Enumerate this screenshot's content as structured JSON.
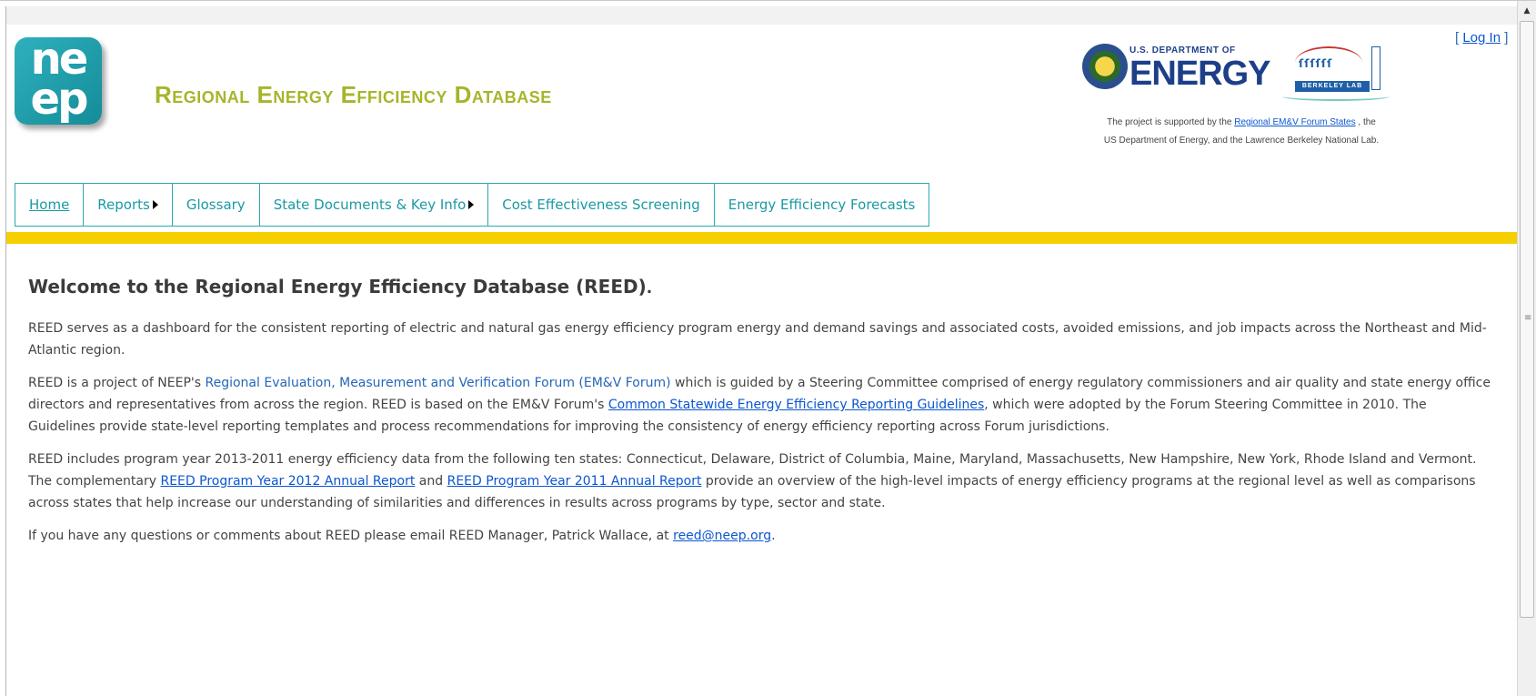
{
  "header": {
    "logo_text": "ne\nep",
    "site_title": "Regional Energy Efficiency Database",
    "login": {
      "open": "[",
      "label": "Log In",
      "close": "]"
    },
    "doe": {
      "small": "U.S. DEPARTMENT OF",
      "big": "ENERGY"
    },
    "berkeley": {
      "label": "BERKELEY LAB"
    },
    "support": {
      "pre": "The project is supported by the ",
      "link": "Regional EM&V Forum States",
      "post": " , the",
      "line2": "US Department of Energy, and the Lawrence Berkeley National Lab."
    }
  },
  "nav": {
    "items": [
      {
        "label": "Home",
        "has_arrow": false,
        "active": true
      },
      {
        "label": "Reports",
        "has_arrow": true
      },
      {
        "label": "Glossary",
        "has_arrow": false
      },
      {
        "label": "State Documents & Key Info",
        "has_arrow": true
      },
      {
        "label": "Cost Effectiveness Screening",
        "has_arrow": false
      },
      {
        "label": "Energy Efficiency Forecasts",
        "has_arrow": false
      }
    ]
  },
  "main": {
    "welcome": "Welcome to the Regional Energy Efficiency Database (REED)",
    "welcome_dot": ".",
    "p1": "REED serves as a dashboard for the consistent reporting of electric and natural gas energy efficiency program energy and demand savings and associated costs, avoided emissions, and job impacts across the Northeast and Mid-Atlantic region.",
    "p2": {
      "a": "REED is a project of NEEP's ",
      "link1": "Regional Evaluation, Measurement and Verification Forum (EM&V Forum)",
      "b": " which is guided by a Steering Committee comprised of energy regulatory commissioners and air quality and state energy office directors and representatives from across the region.  REED is based on the EM&V Forum's ",
      "link2": "Common Statewide Energy Efficiency Reporting Guidelines",
      "c": ", which were adopted by the Forum Steering Committee in 2010. The Guidelines provide state-level reporting templates and process recommendations for improving the consistency of energy efficiency reporting across Forum jurisdictions."
    },
    "p3": {
      "a": "REED includes program year 2013-2011 energy efficiency data from the following ten states: Connecticut, Delaware, District of Columbia, Maine, Maryland, Massachusetts, New Hampshire, New York, Rhode Island and Vermont.  The complementary ",
      "link1": "REED Program Year 2012 Annual Report",
      "b": " and ",
      "link2": "REED Program Year 2011 Annual Report",
      "c": " provide an overview of the high-level impacts of energy efficiency programs at the regional level as well as comparisons across states that help increase our understanding of similarities and differences in results across programs by type, sector and state."
    },
    "p4": {
      "a": "If you have any questions or comments about REED please email REED Manager, Patrick Wallace, at ",
      "link": "reed@neep.org",
      "b": "."
    }
  },
  "scrollbar": {
    "up_icon": "▲",
    "grip_icon": "≡"
  }
}
